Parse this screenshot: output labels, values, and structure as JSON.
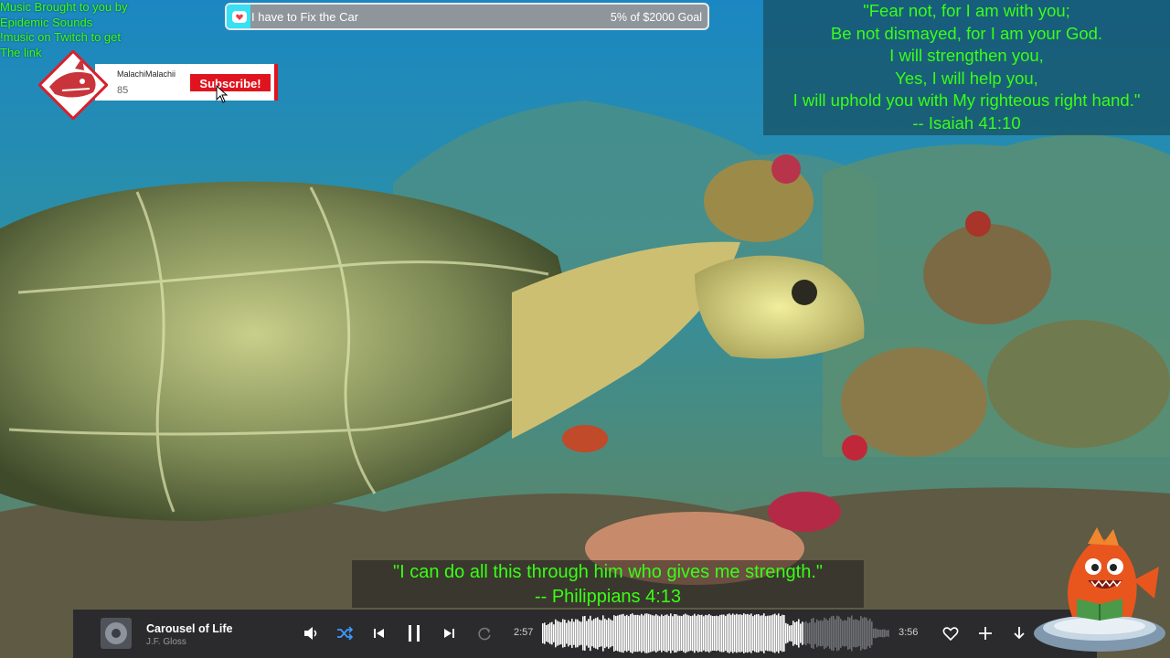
{
  "credit": {
    "lines": [
      "Music Brought to you by",
      "Epidemic Sounds",
      "!music on Twitch to get",
      "The link"
    ]
  },
  "subscribe": {
    "channel_name": "MalachiMalachii",
    "count": "85",
    "button_label": "Subscribe!"
  },
  "goal": {
    "title": "I have to Fix the Car",
    "amount_text": "5% of $2000 Goal",
    "progress_percent": 5,
    "fill_color": "#37e0f5"
  },
  "verse": {
    "lines": [
      "\"Fear not, for I am with you;",
      "Be not dismayed, for I am your God.",
      "I will strengthen you,",
      "Yes, I will help you,",
      "I will uphold you with My righteous right hand.\"",
      "-- Isaiah 41:10"
    ],
    "color": "#39ff14"
  },
  "subtitle": {
    "line1": "\"I can do all this through him who gives me strength.\"",
    "line2": "-- Philippians 4:13"
  },
  "player": {
    "track_title": "Carousel of Life",
    "track_artist": "J.F. Gloss",
    "elapsed": "2:57",
    "duration": "3:56",
    "progress_fraction": 0.75,
    "icons": [
      "volume-icon",
      "shuffle-icon",
      "previous-icon",
      "pause-icon",
      "next-icon",
      "repeat-icon",
      "heart-icon",
      "plus-icon",
      "download-icon"
    ]
  }
}
